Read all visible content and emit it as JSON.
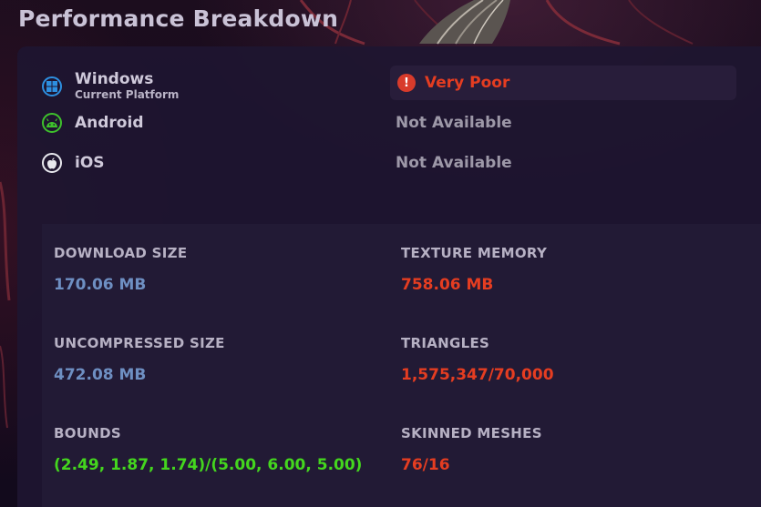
{
  "page": {
    "title": "Performance Breakdown"
  },
  "platforms": [
    {
      "name": "Windows",
      "subtitle": "Current Platform",
      "icon": "windows-icon",
      "status": "Very Poor",
      "status_color": "#e53d21"
    },
    {
      "name": "Android",
      "icon": "android-icon",
      "status": "Not Available"
    },
    {
      "name": "iOS",
      "icon": "apple-icon",
      "status": "Not Available"
    }
  ],
  "warning_icon_glyph": "!",
  "stats": {
    "download_size": {
      "label": "DOWNLOAD SIZE",
      "value": "170.06 MB",
      "color": "#6e8fc2"
    },
    "texture_memory": {
      "label": "TEXTURE MEMORY",
      "value": "758.06 MB",
      "color": "#e53d21"
    },
    "uncompressed_size": {
      "label": "UNCOMPRESSED SIZE",
      "value": "472.08 MB",
      "color": "#6e8fc2"
    },
    "triangles": {
      "label": "TRIANGLES",
      "value": "1,575,347/70,000",
      "color": "#e53d21"
    },
    "bounds": {
      "label": "BOUNDS",
      "value": "(2.49, 1.87, 1.74)/(5.00, 6.00, 5.00)",
      "color": "#44d61e"
    },
    "skinned_meshes": {
      "label": "SKINNED MESHES",
      "value": "76/16",
      "color": "#e53d21"
    }
  }
}
